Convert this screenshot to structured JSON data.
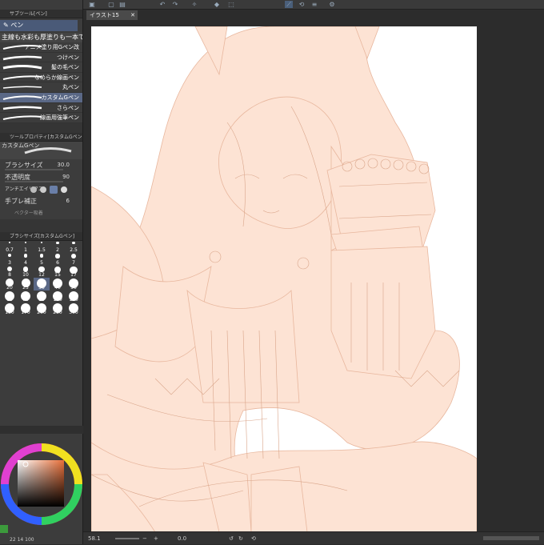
{
  "canvas_tab": "イラスト15",
  "subtool": {
    "panel_title": "サブツール[ペン]",
    "tool_name": "ペン",
    "category": "主線も水彩も厚塗りも一本で",
    "brushes": [
      {
        "label": "アニメ塗り用Gペン改"
      },
      {
        "label": "つけペン"
      },
      {
        "label": "髪の毛ペン"
      },
      {
        "label": "なめらか線画ペン"
      },
      {
        "label": "丸ペン"
      },
      {
        "label": "カスタムGペン"
      },
      {
        "label": "さらペン"
      },
      {
        "label": "線画用強筆ペン"
      }
    ]
  },
  "tool_property": {
    "panel_title": "ツールプロパティ[カスタムGペン]",
    "brush_name": "カスタムGペン",
    "size_label": "ブラシサイズ",
    "size_value": "30.0",
    "opacity_label": "不透明度",
    "opacity_value": "90",
    "aa_label": "アンチエイリアス",
    "stab_label": "手ブレ補正",
    "stab_value": "6",
    "vector_label": "ベクター吸着"
  },
  "brush_size_panel": {
    "title": "ブラシサイズ[カスタムGペン]",
    "sizes": [
      "0.7",
      "1",
      "1.5",
      "2",
      "2.5",
      "3",
      "4",
      "5",
      "6",
      "7",
      "8",
      "10",
      "12",
      "15",
      "17",
      "20",
      "25",
      "30",
      "40",
      "50",
      "60",
      "70",
      "80",
      "100",
      "120",
      "150",
      "170",
      "200",
      "250",
      "300"
    ]
  },
  "status_bar": {
    "zoom": "58.1",
    "angle": "0.0",
    "mini": "22",
    "mini2": "14",
    "mini3": "100"
  },
  "colors": {
    "line": "#f2cbb6",
    "fill": "#fde3d4",
    "selected": "#5a6886"
  }
}
